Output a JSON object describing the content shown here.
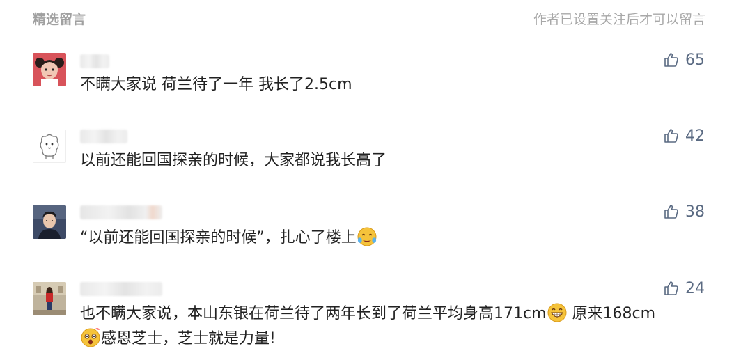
{
  "header": {
    "title": "精选留言",
    "note": "作者已设置关注后才可以留言"
  },
  "colors": {
    "like_icon": "#5a6a82",
    "header_text": "#a0a0a0",
    "content_text": "#222222"
  },
  "comments": [
    {
      "avatar_icon": "girl-portrait-avatar",
      "text": "不瞒大家说 荷兰待了一年 我长了2.5cm",
      "likes": "65"
    },
    {
      "avatar_icon": "cartoon-sheep-avatar",
      "text": "以前还能回国探亲的时候，大家都说我长高了",
      "likes": "42"
    },
    {
      "avatar_icon": "man-portrait-avatar",
      "text": "“以前还能回国探亲的时候”，扎心了楼上",
      "emoji": "crying-face-emoji",
      "likes": "38"
    },
    {
      "avatar_icon": "woman-red-outfit-avatar",
      "text_part1": "也不瞒大家说，本山东银在荷兰待了两年长到了荷兰平均身高171cm",
      "emoji1": "grin-emoji",
      "text_part2": " 原来168cm",
      "emoji2": "shocked-face-emoji",
      "text_part3": "感恩芝士，芝士就是力量!",
      "likes": "24"
    }
  ]
}
